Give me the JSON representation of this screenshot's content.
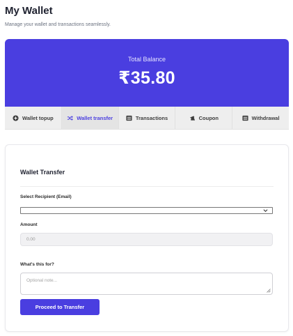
{
  "header": {
    "title": "My Wallet",
    "subtitle": "Manage your wallet and transactions seamlessly."
  },
  "balance": {
    "label": "Total Balance",
    "amount": "₹35.80"
  },
  "tabs": [
    {
      "label": "Wallet topup",
      "icon": "plus-circle-icon"
    },
    {
      "label": "Wallet transfer",
      "icon": "shuffle-icon",
      "active": true
    },
    {
      "label": "Transactions",
      "icon": "list-icon"
    },
    {
      "label": "Coupon",
      "icon": "ticket-icon"
    },
    {
      "label": "Withdrawal",
      "icon": "list-icon"
    }
  ],
  "form": {
    "title": "Wallet Transfer",
    "recipient_label": "Select Recipient (Email)",
    "recipient_value": "",
    "amount_label": "Amount",
    "amount_placeholder": "0.00",
    "note_label": "What's this for?",
    "note_placeholder": "Optional note...",
    "submit_label": "Proceed to Transfer"
  },
  "colors": {
    "accent": "#4a3ee0",
    "tab_bar": "#eeeeee"
  }
}
